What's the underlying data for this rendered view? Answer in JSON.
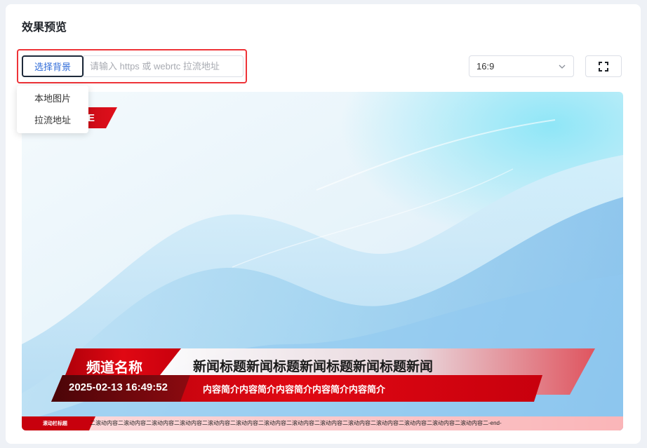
{
  "card": {
    "title": "效果预览"
  },
  "toolbar": {
    "bg_button_label": "选择背景",
    "url_placeholder": "请输入 https 或 webrtc 拉流地址",
    "url_value": "",
    "aspect_ratio": "16:9",
    "fullscreen_icon": "fullscreen-icon",
    "chevron_icon": "chevron-down-icon"
  },
  "dropdown": {
    "items": [
      {
        "label": "本地图片"
      },
      {
        "label": "拉流地址"
      }
    ]
  },
  "preview": {
    "corner_tag": "E",
    "channel_name": "频道名称",
    "news_title": "新闻标题新闻标题新闻标题新闻标题新闻",
    "datetime": "2025-02-13 16:49:52",
    "summary": "内容简介内容简介内容简介内容简介内容简介",
    "ticker_label": "滚动栏标题",
    "ticker_text": "二滚动内容二滚动内容二滚动内容二滚动内容二滚动内容二滚动内容二滚动内容二滚动内容二滚动内容二滚动内容二滚动内容二滚动内容二滚动内容二滚动内容二-end-"
  },
  "colors": {
    "highlight_border": "#ee3338",
    "overlay_red": "#d7000f",
    "link_blue": "#2f6bd8",
    "sky_light": "#e9f5fb",
    "sky_blue": "#8fc8f0"
  }
}
